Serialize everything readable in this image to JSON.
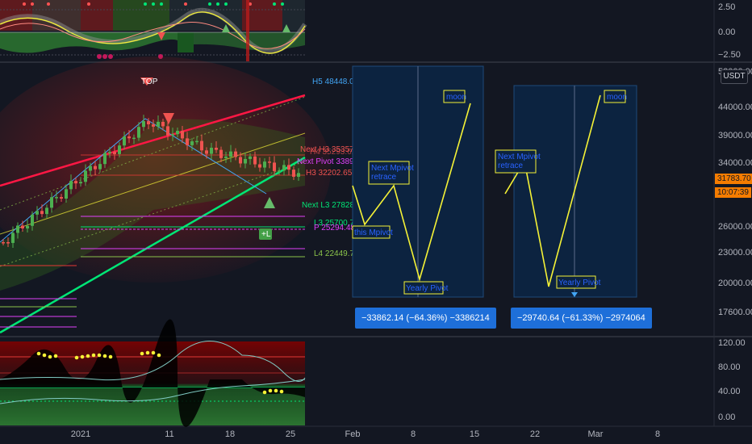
{
  "top_axis": {
    "ticks": [
      "2.50",
      "0.00",
      "−2.50"
    ]
  },
  "main_axis": {
    "ticks": [
      "52000.00",
      "44000.00",
      "39000.00",
      "34000.00",
      "31783.70",
      "26000.00",
      "23000.00",
      "20000.00",
      "17600.00"
    ],
    "currency_button": "USDT"
  },
  "price_tags": {
    "current": "31783.70",
    "timer": "10:07:39"
  },
  "bottom_axis": {
    "ticks": [
      "120.00",
      "80.00",
      "40.00",
      "0.00"
    ]
  },
  "time_axis": {
    "ticks": [
      "2021",
      "11",
      "18",
      "25",
      "Feb",
      "8",
      "15",
      "22",
      "Mar",
      "8"
    ]
  },
  "levels": {
    "h5": "H5 48448.01",
    "next_h3": "Next H3 35357.24",
    "h4": "H4 35293.62",
    "next_pivot": "Next Pivot 33897.74",
    "h3": "H3 32202.65",
    "next_l3": "Next L3 27828.2",
    "l3": "L3 25700.71",
    "p": "P 25294.48",
    "l4": "L4 22449.75"
  },
  "markers": {
    "top_label": "TOP",
    "bottom_label": "+L"
  },
  "projection1": {
    "labels": {
      "moon": "moon",
      "next_mpivot": "Next Mpivot\nretrace",
      "this_mpivot": "this Mpivot",
      "yearly_pivot": "Yearly Pivot"
    },
    "badge": "−33862.14 (−64.36%) −3386214"
  },
  "projection2": {
    "labels": {
      "moon": "moon",
      "next_mpivot": "Next Mpivot\nretrace",
      "yearly_pivot": "Yearly Pivot"
    },
    "badge": "−29740.64 (−61.33%) −2974064"
  },
  "colors": {
    "background": "#131722",
    "resistance": "#ff1744",
    "support": "#00e676",
    "projection_box": "#0c2340",
    "badge": "#1e6fd9",
    "path": "#f5f236"
  }
}
